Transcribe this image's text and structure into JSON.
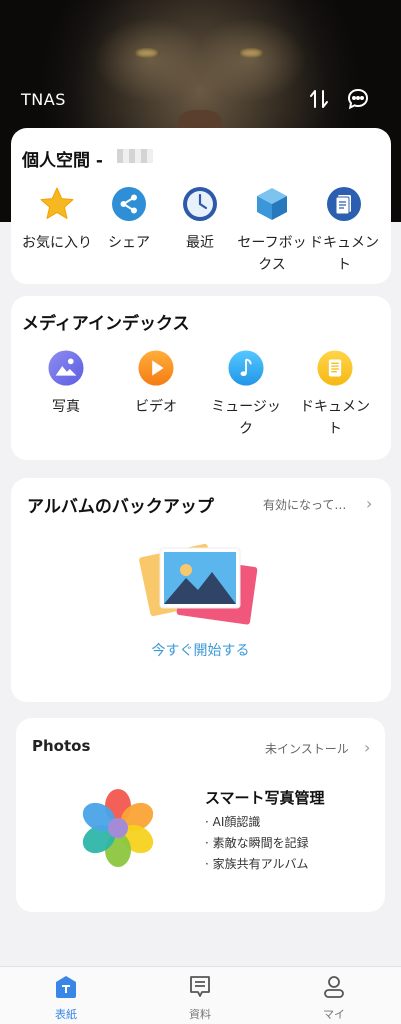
{
  "header": {
    "title": "TNAS"
  },
  "personal": {
    "title": "個人空間 -",
    "items": [
      {
        "label": "お気に入り",
        "icon": "star-icon"
      },
      {
        "label": "シェア",
        "icon": "share-icon"
      },
      {
        "label": "最近",
        "icon": "clock-icon"
      },
      {
        "label": "セーフボックス",
        "icon": "safebox-icon"
      },
      {
        "label": "ドキュメント",
        "icon": "document-icon"
      }
    ]
  },
  "media": {
    "title": "メディアインデックス",
    "items": [
      {
        "label": "写真",
        "icon": "photo-icon"
      },
      {
        "label": "ビデオ",
        "icon": "video-icon"
      },
      {
        "label": "ミュージック",
        "icon": "music-icon"
      },
      {
        "label": "ドキュメント",
        "icon": "document-icon"
      }
    ]
  },
  "album_backup": {
    "title": "アルバムのバックアップ",
    "status": "有効になって…",
    "action": "今すぐ開始する"
  },
  "photos": {
    "title": "Photos",
    "status": "未インストール",
    "feature_title": "スマート写真管理",
    "features": [
      "· AI顔認識",
      "· 素敵な瞬間を記録",
      "· 家族共有アルバム"
    ]
  },
  "tabs": [
    {
      "label": "表紙",
      "active": true
    },
    {
      "label": "資料",
      "active": false
    },
    {
      "label": "マイ",
      "active": false
    }
  ],
  "colors": {
    "accent": "#3a86e6",
    "background": "#f2f2f4"
  }
}
